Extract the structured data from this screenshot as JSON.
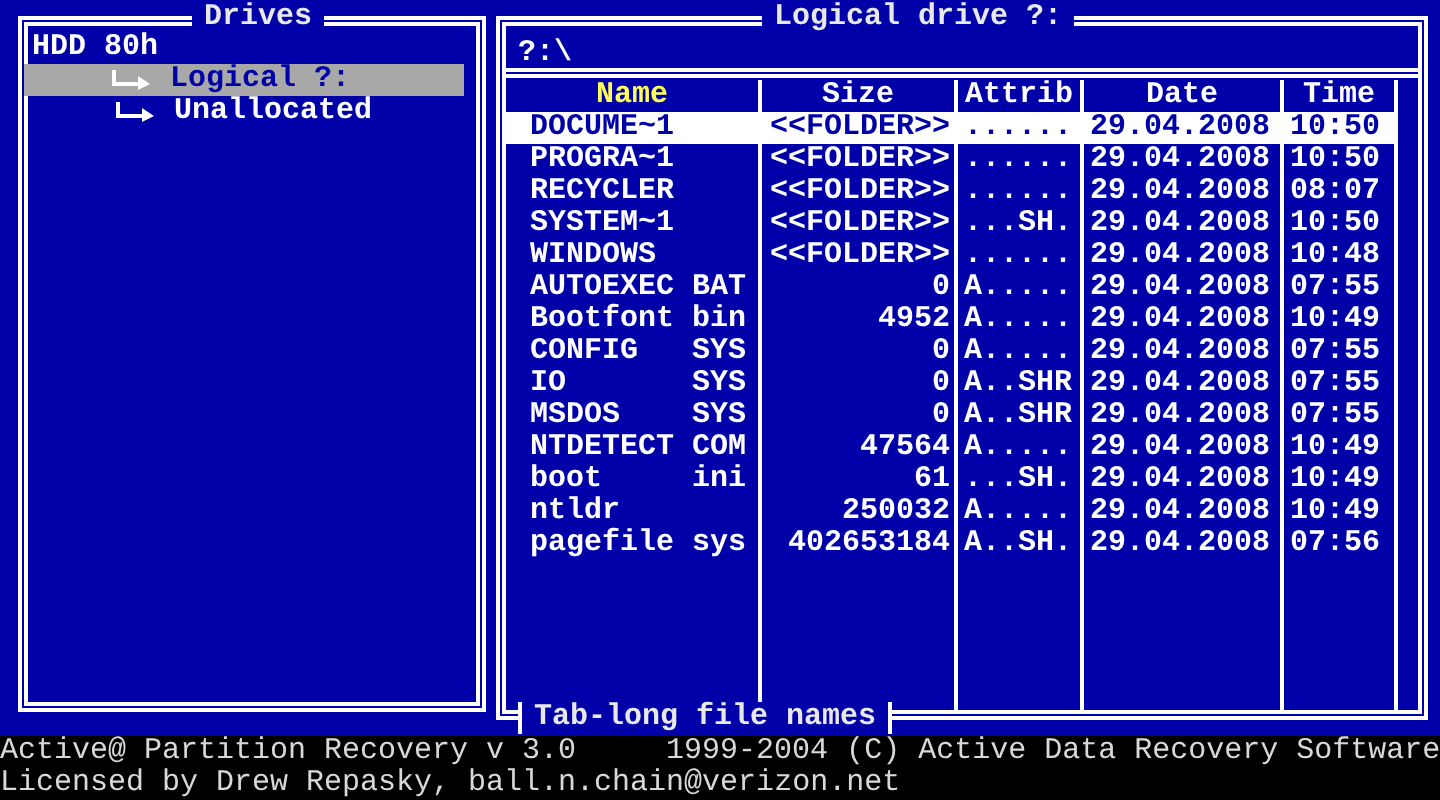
{
  "drives_panel": {
    "title": "Drives",
    "items": [
      {
        "label": "HDD 80h",
        "selected": false,
        "children": [
          {
            "label": "Logical ?:",
            "selected": true
          },
          {
            "label": "Unallocated",
            "selected": false
          }
        ]
      }
    ]
  },
  "drive_panel": {
    "title": "Logical drive ?:",
    "path": "?:\\",
    "columns": [
      {
        "label": "Name",
        "sorted": true
      },
      {
        "label": "Size",
        "sorted": false
      },
      {
        "label": "Attrib",
        "sorted": false
      },
      {
        "label": "Date",
        "sorted": false
      },
      {
        "label": "Time",
        "sorted": false
      }
    ],
    "rows": [
      {
        "selected": true,
        "cells": [
          "DOCUME~1",
          "<<FOLDER>>",
          "......",
          "29.04.2008",
          "10:50"
        ]
      },
      {
        "selected": false,
        "cells": [
          "PROGRA~1",
          "<<FOLDER>>",
          "......",
          "29.04.2008",
          "10:50"
        ]
      },
      {
        "selected": false,
        "cells": [
          "RECYCLER",
          "<<FOLDER>>",
          "......",
          "29.04.2008",
          "08:07"
        ]
      },
      {
        "selected": false,
        "cells": [
          "SYSTEM~1",
          "<<FOLDER>>",
          "...SH.",
          "29.04.2008",
          "10:50"
        ]
      },
      {
        "selected": false,
        "cells": [
          "WINDOWS",
          "<<FOLDER>>",
          "......",
          "29.04.2008",
          "10:48"
        ]
      },
      {
        "selected": false,
        "cells": [
          "AUTOEXEC BAT",
          "0",
          "A.....",
          "29.04.2008",
          "07:55"
        ]
      },
      {
        "selected": false,
        "cells": [
          "Bootfont bin",
          "4952",
          "A.....",
          "29.04.2008",
          "10:49"
        ]
      },
      {
        "selected": false,
        "cells": [
          "CONFIG   SYS",
          "0",
          "A.....",
          "29.04.2008",
          "07:55"
        ]
      },
      {
        "selected": false,
        "cells": [
          "IO       SYS",
          "0",
          "A..SHR",
          "29.04.2008",
          "07:55"
        ]
      },
      {
        "selected": false,
        "cells": [
          "MSDOS    SYS",
          "0",
          "A..SHR",
          "29.04.2008",
          "07:55"
        ]
      },
      {
        "selected": false,
        "cells": [
          "NTDETECT COM",
          "47564",
          "A.....",
          "29.04.2008",
          "10:49"
        ]
      },
      {
        "selected": false,
        "cells": [
          "boot     ini",
          "61",
          "...SH.",
          "29.04.2008",
          "10:49"
        ]
      },
      {
        "selected": false,
        "cells": [
          "ntldr",
          "250032",
          "A.....",
          "29.04.2008",
          "10:49"
        ]
      },
      {
        "selected": false,
        "cells": [
          "pagefile sys",
          "402653184",
          "A..SH.",
          "29.04.2008",
          "07:56"
        ]
      }
    ],
    "footer": "Tab-long file names"
  },
  "status_bar": {
    "lines": [
      [
        "Active@ Partition Recovery v 3.0",
        "1999-2004 (C) Active Data Recovery Software"
      ],
      [
        "Licensed by Drew Repasky, ball.n.chain@verizon.net"
      ]
    ]
  }
}
